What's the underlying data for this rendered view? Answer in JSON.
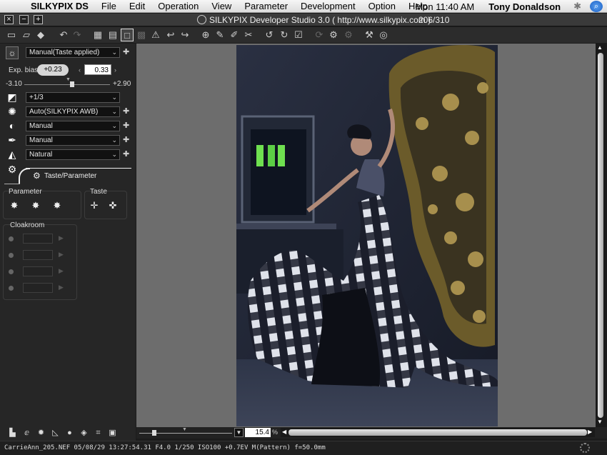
{
  "menubar": {
    "app_name": "SILKYPIX DS",
    "menus": [
      "File",
      "Edit",
      "Operation",
      "View",
      "Parameter",
      "Development",
      "Option",
      "Help"
    ],
    "clock": "Mon 11:40 AM",
    "user": "Tony Donaldson"
  },
  "window": {
    "title": "SILKYPIX Developer Studio 3.0 ( http://www.silkypix.com )",
    "image_count": "206/310"
  },
  "left_panel": {
    "taste_dropdown": "Manual(Taste applied)",
    "exposure": {
      "label": "Exp. bias",
      "pill_value": "+0.23",
      "input_value": "0.33",
      "min": "-3.10",
      "max": "+2.90"
    },
    "dropdowns": {
      "contrast": "+1/3",
      "white_balance": "Auto(SILKYPIX AWB)",
      "tone": "Manual",
      "sharpness": "Manual",
      "color": "Natural"
    },
    "tab_label": "Taste/Parameter",
    "groups": {
      "parameter_title": "Parameter",
      "taste_title": "Taste",
      "cloakroom_title": "Cloakroom"
    }
  },
  "zoom": {
    "value": "15.4",
    "unit": "%"
  },
  "status": {
    "info": "CarrieAnn_205.NEF 05/08/29 13:27:54.31 F4.0 1/250 ISO100 +0.7EV M(Pattern) f=50.0mm"
  }
}
